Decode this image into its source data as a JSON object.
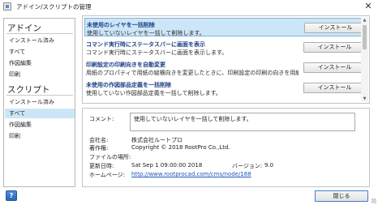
{
  "window": {
    "title": "アドイン/スクリプトの管理",
    "close_glyph": "✕"
  },
  "sidebar": {
    "addin_heading": "アドイン",
    "addin_items": [
      {
        "label": "インストール済み",
        "selected": false
      },
      {
        "label": "すべて",
        "selected": false
      },
      {
        "label": "作図編集",
        "selected": false
      },
      {
        "label": "印刷",
        "selected": false
      }
    ],
    "script_heading": "スクリプト",
    "script_items": [
      {
        "label": "インストール済み",
        "selected": false
      },
      {
        "label": "すべて",
        "selected": true
      },
      {
        "label": "作図編集",
        "selected": false
      },
      {
        "label": "印刷",
        "selected": false
      }
    ]
  },
  "plugins": [
    {
      "name": "未使用のレイヤを一括削除",
      "desc": "使用していないレイヤを一括して削除します。",
      "button": "インストール",
      "selected": true
    },
    {
      "name": "コマンド実行時にステータスバーに画面を表示",
      "desc": "コマンド実行時にステータスバーに画面を表示します。",
      "button": "インストール",
      "selected": false
    },
    {
      "name": "印刷設定の印刷向きを自動変更",
      "desc": "用紙のプロパティで用紙の縦横向きを変更したときに、印刷設定の印刷の向きを用紙の向きに合わせて自…",
      "button": "インストール",
      "selected": false
    },
    {
      "name": "未使用の作図部品定義を一括削除",
      "desc": "使用していない作図部品定義を一括して削除します。",
      "button": "インストール",
      "selected": false
    }
  ],
  "details": {
    "comment_label": "コメント:",
    "comment_value": "使用していないレイヤを一括して削除します。",
    "company_label": "会社名:",
    "company_value": "株式会社ルートプロ",
    "copyright_label": "著作権:",
    "copyright_value": "Copyright © 2018 RootPro Co.,Ltd.",
    "file_location_label": "ファイルの場所:",
    "file_location_value": "",
    "updated_label": "更新日時:",
    "updated_value": "Sat Sep  1 09:00:00 2018",
    "version_label": "バージョン:",
    "version_value": "9.0",
    "homepage_label": "ホームページ:",
    "homepage_value": "http://www.rootprocad.com/cms/node/188"
  },
  "footer": {
    "help_label": "?",
    "close_label": "閉じる"
  },
  "colors": {
    "selected_bg": "#cde6f7",
    "plugin_name": "#1d3f86",
    "link": "#1f55c4"
  }
}
